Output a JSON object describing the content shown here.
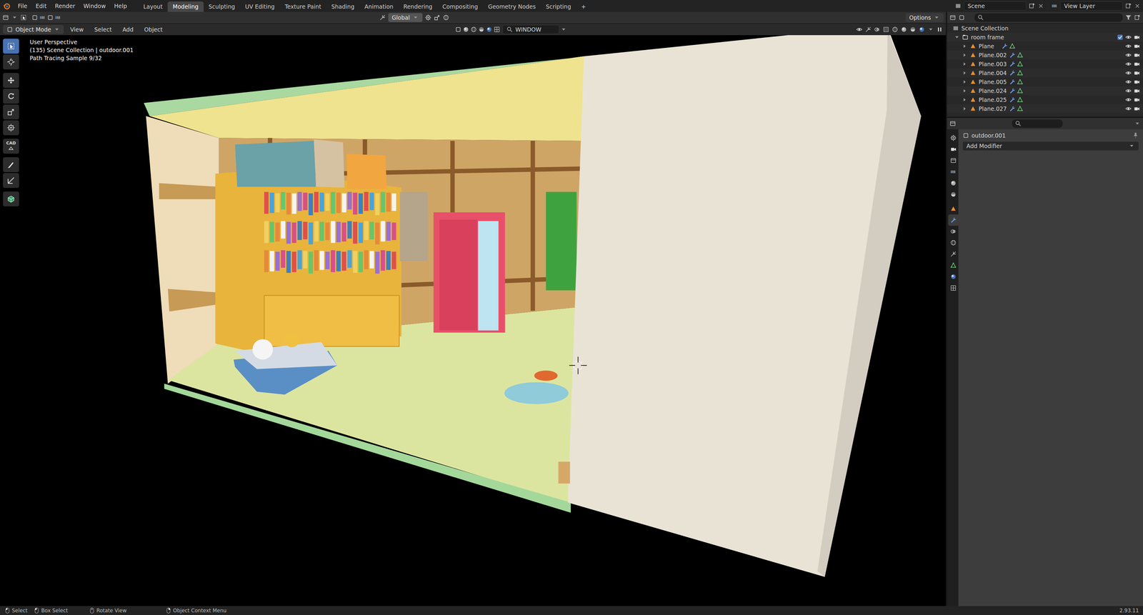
{
  "top_menu": [
    {
      "label": "File"
    },
    {
      "label": "Edit"
    },
    {
      "label": "Render"
    },
    {
      "label": "Window"
    },
    {
      "label": "Help"
    }
  ],
  "workspaces": [
    {
      "label": "Layout",
      "selected": false
    },
    {
      "label": "Modeling",
      "selected": true
    },
    {
      "label": "Sculpting",
      "selected": false
    },
    {
      "label": "UV Editing",
      "selected": false
    },
    {
      "label": "Texture Paint",
      "selected": false
    },
    {
      "label": "Shading",
      "selected": false
    },
    {
      "label": "Animation",
      "selected": false
    },
    {
      "label": "Rendering",
      "selected": false
    },
    {
      "label": "Compositing",
      "selected": false
    },
    {
      "label": "Geometry Nodes",
      "selected": false
    },
    {
      "label": "Scripting",
      "selected": false
    }
  ],
  "add_workspace": "+",
  "scene": "Scene",
  "view_layer": "View Layer",
  "tool_header": {
    "orientation": "Global",
    "options": "Options"
  },
  "viewport_header": {
    "mode": "Object Mode",
    "menus": [
      "View",
      "Select",
      "Add",
      "Object"
    ],
    "shading_target": "WINDOW"
  },
  "viewport_info": [
    "User Perspective",
    "(135) Scene Collection | outdoor.001",
    "Path Tracing Sample 9/32"
  ],
  "tools": [
    {
      "selected": true
    },
    {
      "selected": false
    },
    {
      "selected": false
    },
    {
      "selected": false
    },
    {
      "selected": false
    },
    {
      "selected": false
    },
    {
      "label": "CAD",
      "selected": false
    },
    {
      "selected": false
    },
    {
      "selected": false
    },
    {
      "selected": false
    }
  ],
  "outliner": {
    "root": "Scene Collection",
    "collection": {
      "label": "room frame",
      "checked": true,
      "visible": true,
      "renderable": true
    },
    "items": [
      {
        "label": "Plane",
        "visible": true,
        "renderable": true
      },
      {
        "label": "Plane.002",
        "visible": true,
        "renderable": true
      },
      {
        "label": "Plane.003",
        "visible": true,
        "renderable": true
      },
      {
        "label": "Plane.004",
        "visible": true,
        "renderable": true
      },
      {
        "label": "Plane.005",
        "visible": true,
        "renderable": true
      },
      {
        "label": "Plane.024",
        "visible": true,
        "renderable": true
      },
      {
        "label": "Plane.025",
        "visible": true,
        "renderable": true
      },
      {
        "label": "Plane.027",
        "visible": true,
        "renderable": true
      }
    ]
  },
  "properties": {
    "object": "outdoor.001",
    "add_modifier": "Add Modifier",
    "tabs": [
      {
        "selected": false
      },
      {
        "selected": false
      },
      {
        "selected": false
      },
      {
        "selected": false
      },
      {
        "selected": false
      },
      {
        "selected": false
      },
      {
        "selected": false
      },
      {
        "selected": true
      },
      {
        "selected": false
      },
      {
        "selected": false
      },
      {
        "selected": false
      },
      {
        "selected": false
      },
      {
        "selected": false
      },
      {
        "selected": false
      }
    ]
  },
  "status_bar": {
    "items": [
      "Select",
      "Box Select",
      "Rotate View",
      "Object Context Menu"
    ],
    "version": "2.93.11"
  }
}
